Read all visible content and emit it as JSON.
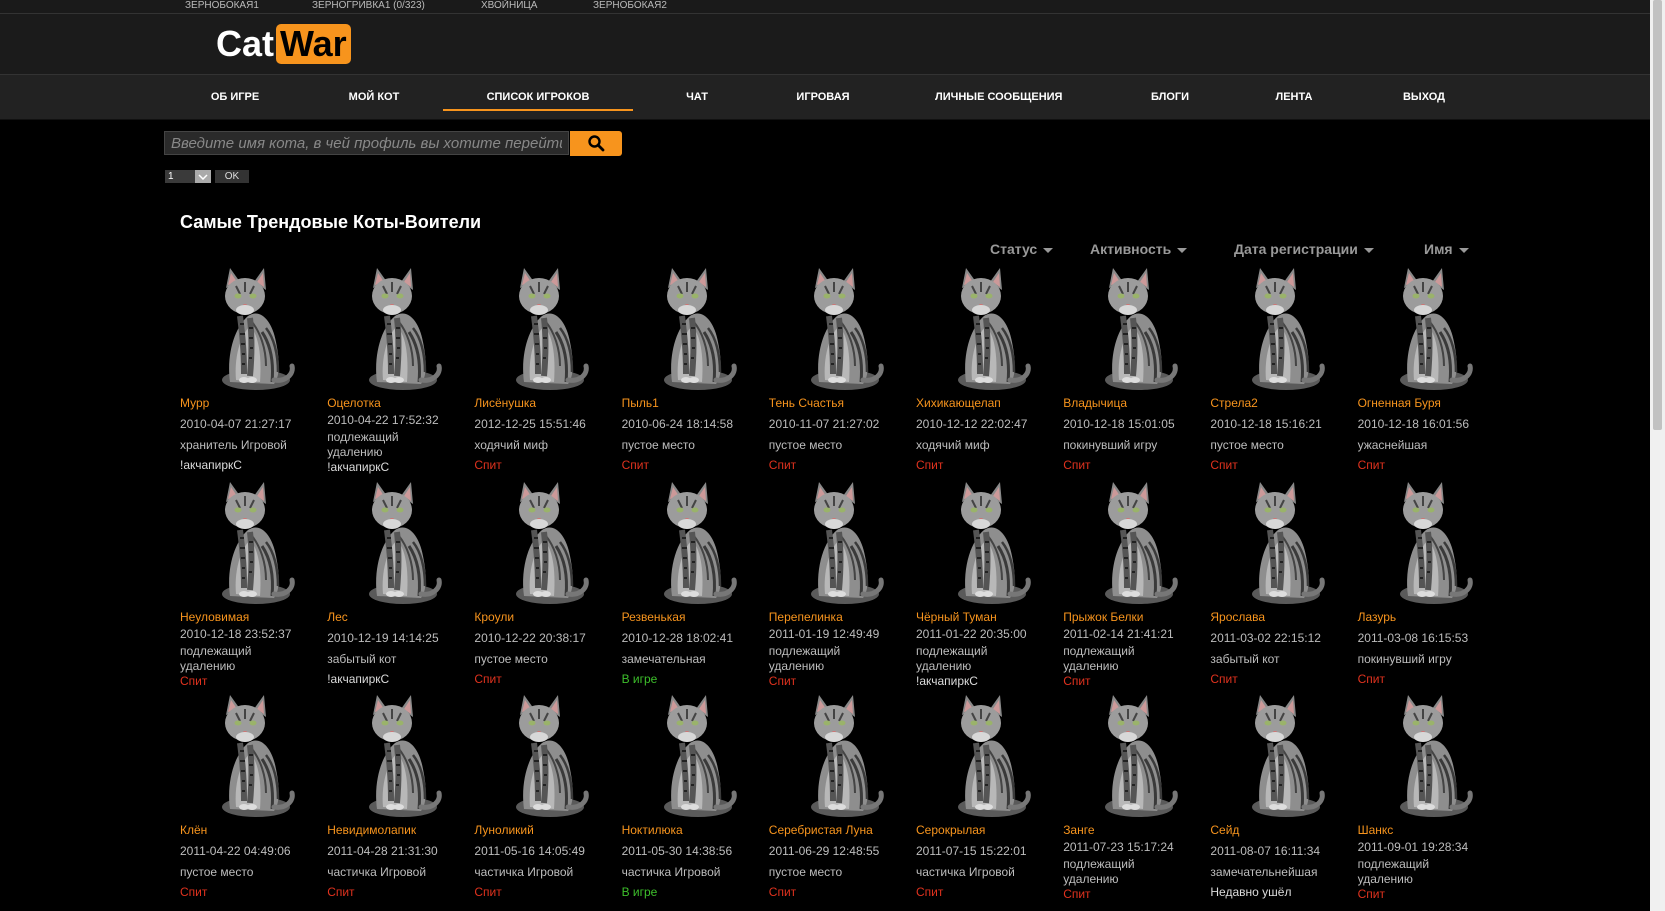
{
  "top_tabs": [
    "ЗЕРНОБОКАЯ1",
    "ЗЕРНОГРИВКА1 (0/323)",
    "ХВОЙНИЦА",
    "ЗЕРНОБОКАЯ2"
  ],
  "logo": {
    "cat": "Cat",
    "war": "War"
  },
  "nav": [
    "ОБ ИГРЕ",
    "МОЙ КОТ",
    "СПИСОК ИГРОКОВ",
    "ЧАТ",
    "ИГРОВАЯ",
    "ЛИЧНЫЕ СООБЩЕНИЯ",
    "БЛОГИ",
    "ЛЕНТА",
    "ВЫХОД"
  ],
  "nav_active": "СПИСОК ИГРОКОВ",
  "search": {
    "placeholder": "Введите имя кота, в чей профиль вы хотите перейти"
  },
  "pager": {
    "value": "1",
    "ok": "OK"
  },
  "section_title": "Самые Трендовые Коты-Воители",
  "sort": [
    "Статус",
    "Активность",
    "Дата регистрации",
    "Имя"
  ],
  "accent": "#f7941d",
  "cats": [
    {
      "name": "Мурр",
      "date": "2010-04-07 21:27:17",
      "role": "хранитель Игровой",
      "status": "!акчапиркС",
      "status_kind": "text"
    },
    {
      "name": "Оцелотка",
      "date": "2010-04-22 17:52:32",
      "role": "подлежащий удалению",
      "status": "!акчапиркС",
      "status_kind": "text"
    },
    {
      "name": "Лисёнушка",
      "date": "2012-12-25 15:51:46",
      "role": "ходячий миф",
      "status": "Спит",
      "status_kind": "sleep"
    },
    {
      "name": "Пыль1",
      "date": "2010-06-24 18:14:58",
      "role": "пустое место",
      "status": "Спит",
      "status_kind": "sleep"
    },
    {
      "name": "Тень Счастья",
      "date": "2010-11-07 21:27:02",
      "role": "пустое место",
      "status": "Спит",
      "status_kind": "sleep"
    },
    {
      "name": "Хихикающелап",
      "date": "2010-12-12 22:02:47",
      "role": "ходячий миф",
      "status": "Спит",
      "status_kind": "sleep"
    },
    {
      "name": "Владычица",
      "date": "2010-12-18 15:01:05",
      "role": "покинувший игру",
      "status": "Спит",
      "status_kind": "sleep"
    },
    {
      "name": "Стрела2",
      "date": "2010-12-18 15:16:21",
      "role": "пустое место",
      "status": "Спит",
      "status_kind": "sleep"
    },
    {
      "name": "Огненная Буря",
      "date": "2010-12-18 16:01:56",
      "role": "ужаснейшая",
      "status": "Спит",
      "status_kind": "sleep"
    },
    {
      "name": "Неуловимая",
      "date": "2010-12-18 23:52:37",
      "role": "подлежащий удалению",
      "status": "Спит",
      "status_kind": "sleep"
    },
    {
      "name": "Лес",
      "date": "2010-12-19 14:14:25",
      "role": "забытый кот",
      "status": "!акчапиркС",
      "status_kind": "text"
    },
    {
      "name": "Кроули",
      "date": "2010-12-22 20:38:17",
      "role": "пустое место",
      "status": "Спит",
      "status_kind": "sleep"
    },
    {
      "name": "Резвенькая",
      "date": "2010-12-28 18:02:41",
      "role": "замечательная",
      "status": "В игре",
      "status_kind": "game"
    },
    {
      "name": "Перепелинка",
      "date": "2011-01-19 12:49:49",
      "role": "подлежащий удалению",
      "status": "Спит",
      "status_kind": "sleep"
    },
    {
      "name": "Чёрный Туман",
      "date": "2011-01-22 20:35:00",
      "role": "подлежащий удалению",
      "status": "!акчапиркС",
      "status_kind": "text"
    },
    {
      "name": "Прыжок Белки",
      "date": "2011-02-14 21:41:21",
      "role": "подлежащий удалению",
      "status": "Спит",
      "status_kind": "sleep"
    },
    {
      "name": "Ярослава",
      "date": "2011-03-02 22:15:12",
      "role": "забытый кот",
      "status": "Спит",
      "status_kind": "sleep"
    },
    {
      "name": "Лазурь",
      "date": "2011-03-08 16:15:53",
      "role": "покинувший игру",
      "status": "Спит",
      "status_kind": "sleep"
    },
    {
      "name": "Клён",
      "date": "2011-04-22 04:49:06",
      "role": "пустое место",
      "status": "Спит",
      "status_kind": "sleep"
    },
    {
      "name": "Невидимолапик",
      "date": "2011-04-28 21:31:30",
      "role": "частичка Игровой",
      "status": "Спит",
      "status_kind": "sleep"
    },
    {
      "name": "Луноликий",
      "date": "2011-05-16 14:05:49",
      "role": "частичка Игровой",
      "status": "Спит",
      "status_kind": "sleep"
    },
    {
      "name": "Ноктилюка",
      "date": "2011-05-30 14:38:56",
      "role": "частичка Игровой",
      "status": "В игре",
      "status_kind": "game"
    },
    {
      "name": "Серебристая Луна",
      "date": "2011-06-29 12:48:55",
      "role": "пустое место",
      "status": "Спит",
      "status_kind": "sleep"
    },
    {
      "name": "Серокрылая",
      "date": "2011-07-15 15:22:01",
      "role": "частичка Игровой",
      "status": "Спит",
      "status_kind": "sleep"
    },
    {
      "name": "Занге",
      "date": "2011-07-23 15:17:24",
      "role": "подлежащий удалению",
      "status": "Спит",
      "status_kind": "sleep"
    },
    {
      "name": "Сейд",
      "date": "2011-08-07 16:11:34",
      "role": "замечательнейшая",
      "status": "Недавно ушёл",
      "status_kind": "text"
    },
    {
      "name": "Шанкс",
      "date": "2011-09-01 19:28:34",
      "role": "подлежащий удалению",
      "status": "Спит",
      "status_kind": "sleep"
    }
  ]
}
